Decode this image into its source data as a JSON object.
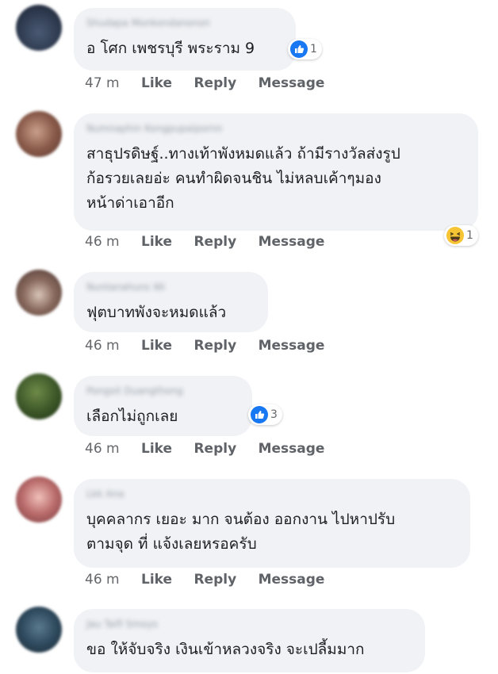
{
  "comments": [
    {
      "author": "Shudapa Monkondanonon",
      "text": "อ โศก เพชรบุรี พระราม 9",
      "time": "47 m",
      "like": "Like",
      "reply": "Reply",
      "message": "Message",
      "reaction": {
        "icon": "like-icon",
        "count": "1"
      },
      "avatar_color": "#2e3a4f"
    },
    {
      "author": "Numnaphin Kongpupaipornn",
      "text": "สาธุปรดิษฐ์..ทางเท้าพังหมดแล้ว ถ้ามีรางวัลส่งรูป\nก้อรวยเลยอ่ะ คนทำผิดจนชิน ไม่หลบเค้าๆมอง\nหน้าด่าเอาอีก",
      "time": "46 m",
      "like": "Like",
      "reply": "Reply",
      "message": "Message",
      "reaction": {
        "icon": "haha-icon",
        "count": "1"
      },
      "avatar_color": "#8a5a4a"
    },
    {
      "author": "Nuntanahuns Wi",
      "text": "ฟุตบาทพังจะหมดแล้ว",
      "time": "46 m",
      "like": "Like",
      "reply": "Reply",
      "message": "Message",
      "avatar_color": "#6b4a3e"
    },
    {
      "author": "Pongsit Duangthong",
      "text": "เลือกไม่ถูกเลย",
      "time": "46 m",
      "like": "Like",
      "reply": "Reply",
      "message": "Message",
      "reaction": {
        "icon": "like-icon",
        "count": "3"
      },
      "avatar_color": "#3f5a2a"
    },
    {
      "author": "Lkk Ana",
      "text": "บุคคลากร เยอะ มาก จนต้อง ออกงาน ไปหาปรับ\nตามจุด ที่ แจ้งเลยหรอครับ",
      "time": "46 m",
      "like": "Like",
      "reply": "Reply",
      "message": "Message",
      "avatar_color": "#b86a6a"
    },
    {
      "author": "Jau Taifi Smoys",
      "text": "ขอ ให้จับจริง เงินเข้าหลวงจริง จะเปลี้มมาก",
      "avatar_color": "#2f4a5e"
    }
  ],
  "colors": {
    "bubble": "#f0f2f5",
    "like_blue": "#1877f2",
    "haha_yellow": "#f7c433"
  }
}
